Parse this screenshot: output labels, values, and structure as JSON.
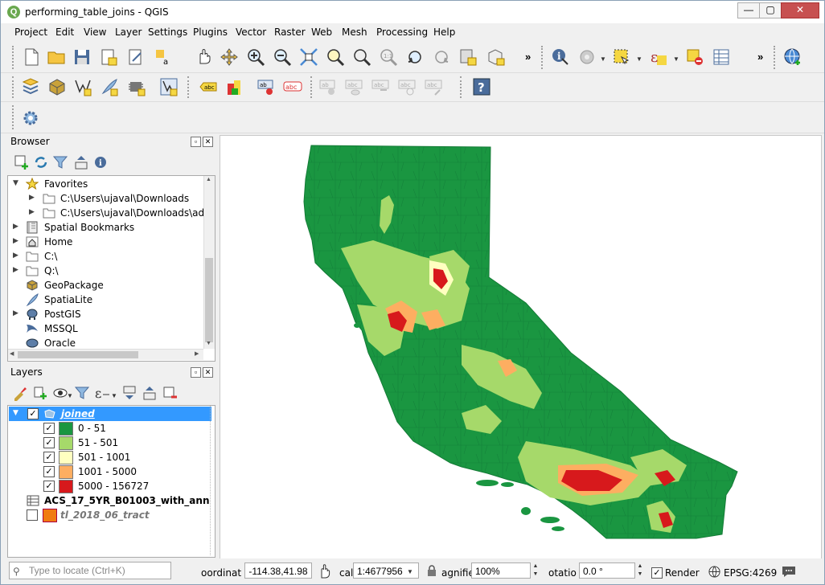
{
  "window": {
    "title": "performing_table_joins - QGIS",
    "app_icon_letter": "Q",
    "minimize": "—",
    "maximize": "▢",
    "close": "✕"
  },
  "menu": [
    "Project",
    "Edit",
    "View",
    "Layer",
    "Settings",
    "Plugins",
    "Vector",
    "Raster",
    "Web",
    "Mesh",
    "Processing",
    "Help"
  ],
  "toolbar": {
    "overflow": "»",
    "sample_labels": {
      "abc": "abc",
      "ab": "ab"
    },
    "help": "?"
  },
  "browser": {
    "title": "Browser",
    "items": [
      {
        "label": "Favorites",
        "icon": "star-icon"
      },
      {
        "label": "C:\\Users\\ujaval\\Downloads",
        "icon": "folder-icon"
      },
      {
        "label": "C:\\Users\\ujaval\\Downloads\\advar",
        "icon": "folder-icon"
      },
      {
        "label": "Spatial Bookmarks",
        "icon": "bookmark-icon"
      },
      {
        "label": "Home",
        "icon": "home-icon"
      },
      {
        "label": "C:\\",
        "icon": "folder-icon"
      },
      {
        "label": "Q:\\",
        "icon": "folder-icon"
      },
      {
        "label": "GeoPackage",
        "icon": "geopackage-icon"
      },
      {
        "label": "SpatiaLite",
        "icon": "spatialite-icon"
      },
      {
        "label": "PostGIS",
        "icon": "postgis-icon"
      },
      {
        "label": "MSSQL",
        "icon": "mssql-icon"
      },
      {
        "label": "Oracle",
        "icon": "oracle-icon"
      }
    ]
  },
  "layers": {
    "title": "Layers",
    "joined": "joined",
    "legend": [
      {
        "label": "0 - 51",
        "color": "#1a9641"
      },
      {
        "label": "51 - 501",
        "color": "#a6d96a"
      },
      {
        "label": "501 - 1001",
        "color": "#ffffc0"
      },
      {
        "label": "1001 - 5000",
        "color": "#fdae61"
      },
      {
        "label": "5000 - 156727",
        "color": "#d7191c"
      }
    ],
    "table_layer": "ACS_17_5YR_B01003_with_ann",
    "tract_layer": "tl_2018_06_tract",
    "check": "✓"
  },
  "status": {
    "locate_placeholder": "Type to locate (Ctrl+K)",
    "coord_label": "oordinat",
    "coord_value": "-114.38,41.98",
    "scale_label": "cal",
    "scale_value": "1:4677956",
    "magnifier_label": "agnifie",
    "magnifier_value": "100%",
    "rotation_label": "otatio",
    "rotation_value": "0.0 °",
    "render_label": "Render",
    "crs": "EPSG:4269"
  }
}
